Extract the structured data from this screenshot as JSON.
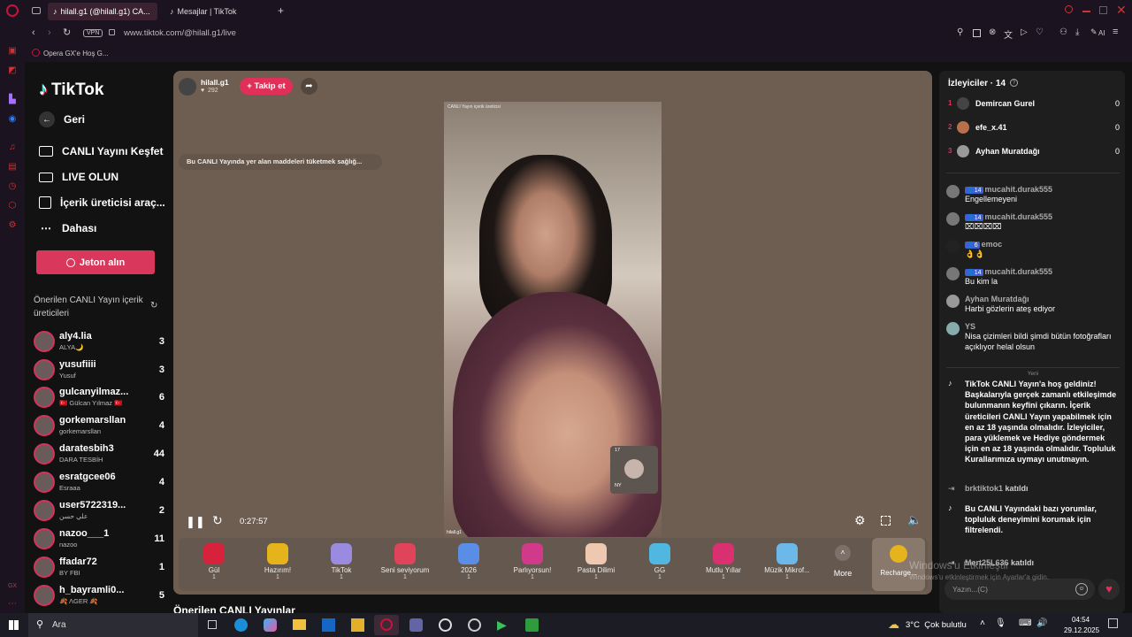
{
  "browser": {
    "tabs": [
      {
        "label": "hilall.g1 (@hilall.g1) CA..."
      },
      {
        "label": "Mesajlar | TikTok"
      }
    ],
    "new_tab": "+",
    "url": "www.tiktok.com/@hilall.g1/live",
    "vpn": "VPN",
    "bookmark": "Opera GX'e Hoş G...",
    "ai": "AI",
    "gx": "GX"
  },
  "nav": {
    "logo": "TikTok",
    "back": "Geri",
    "items": [
      {
        "label": "CANLI Yayını Keşfet"
      },
      {
        "label": "LIVE OLUN"
      },
      {
        "label": "İçerik üreticisi araç..."
      },
      {
        "label": "Dahası"
      }
    ],
    "coins": "Jeton alın",
    "suggested_title": "Önerilen CANLI Yayın içerik üreticileri",
    "accounts": [
      {
        "name": "aly4.lia",
        "sub": "ALYA🌙",
        "count": "3"
      },
      {
        "name": "yusufiiii",
        "sub": "Yusuf",
        "count": "3"
      },
      {
        "name": "gulcanyilmaz...",
        "sub": "🇹🇷 Gülcan Yılmaz 🇹🇷",
        "count": "6"
      },
      {
        "name": "gorkemarsllan",
        "sub": "gorkemarsllan",
        "count": "4"
      },
      {
        "name": "daratesbih3",
        "sub": "DARA TESBİH",
        "count": "44"
      },
      {
        "name": "esratgcee06",
        "sub": "Esraaa",
        "count": "4"
      },
      {
        "name": "user5722319...",
        "sub": "علي حسن",
        "count": "2"
      },
      {
        "name": "nazoo___1",
        "sub": "nazoo",
        "count": "11"
      },
      {
        "name": "ffadar72",
        "sub": "BY FBI",
        "count": "1"
      },
      {
        "name": "h_bayramli0...",
        "sub": "🍂 ΛGER 🍂",
        "count": "5"
      }
    ]
  },
  "stream": {
    "host": "hilall.g1",
    "host_likes": "292",
    "follow": "+ Takip et",
    "notice": "Bu CANLI Yayında yer alan maddeleri tüketmek sağlığ...",
    "video_tag": "CANLI Yayın içerik üreticisi",
    "watermark": "hilall.g1",
    "pip_count": "17",
    "pip_label": "NY",
    "time": "0:27:57",
    "section_title": "Önerilen CANLI Yayınlar"
  },
  "gifts": [
    {
      "label": "Gül",
      "price": "1",
      "color": "#d7223e"
    },
    {
      "label": "Hazırım!",
      "price": "1",
      "color": "#e5b31c"
    },
    {
      "label": "TikTok",
      "price": "1",
      "color": "#9b8be0"
    },
    {
      "label": "Seni seviyorum",
      "price": "1",
      "color": "#e0445a"
    },
    {
      "label": "2026",
      "price": "1",
      "color": "#5a8ee6"
    },
    {
      "label": "Parlıyorsun!",
      "price": "1",
      "color": "#d13a8a"
    },
    {
      "label": "Pasta Dilimi",
      "price": "1",
      "color": "#eec8b0"
    },
    {
      "label": "GG",
      "price": "1",
      "color": "#4fb7e0"
    },
    {
      "label": "Mutlu Yıllar",
      "price": "1",
      "color": "#d93070"
    },
    {
      "label": "Müzik Mikrof...",
      "price": "1",
      "color": "#6cb8e8"
    }
  ],
  "gift_more": "More",
  "recharge": "Recharge...",
  "viewers": {
    "title": "İzleyiciler · 14",
    "list": [
      {
        "rank": "1",
        "name": "Demircan Gurel",
        "score": "0"
      },
      {
        "rank": "2",
        "name": "efe_x.41",
        "score": "0"
      },
      {
        "rank": "3",
        "name": "Ayhan Muratdağı",
        "score": "0"
      }
    ]
  },
  "chat": [
    {
      "badge": "14",
      "user": "mucahit.durak555",
      "msg": "Engellemeyeni"
    },
    {
      "badge": "14",
      "user": "mucahit.durak555",
      "msg": "⌧⌧⌧⌧"
    },
    {
      "badge": "6",
      "user": "emoc",
      "msg": "👌👌"
    },
    {
      "badge": "14",
      "user": "mucahit.durak555",
      "msg": "Bu kim la"
    },
    {
      "badge": "",
      "user": "Ayhan Muratdağı",
      "msg": "Harbi gözlerin ateş ediyor"
    },
    {
      "badge": "",
      "user": "YS",
      "msg": "Nisa çizimleri bildi şimdi bütün fotoğrafları açıklıyor helal olsun"
    }
  ],
  "new_label": "Yeni",
  "system": "TikTok CANLI Yayın'a hoş geldiniz! Başkalarıyla gerçek zamanlı etkileşimde bulunmanın keyfini çıkarın. İçerik üreticileri CANLI Yayın yapabilmek için en az 18 yaşında olmalıdır. İzleyiciler, para yüklemek ve Hediye göndermek için en az 18 yaşında olmalıdır. Topluluk Kurallarımıza uymayı unutmayın.",
  "joined1": {
    "user": "brktiktok1",
    "text": "katıldı"
  },
  "filter_msg": "Bu CANLI Yayındaki bazı yorumlar, topluluk deneyimini korumak için filtrelendi.",
  "joined2": {
    "user": "Mert25L636",
    "text": "katıldı"
  },
  "chat_placeholder": "Yazın...(C)",
  "windows_watermark": "Windows'u Etkinleştir",
  "windows_watermark2": "Windows'u etkinleştirmek için Ayarlar'a gidin.",
  "taskbar": {
    "search": "Ara",
    "weather": "3°C  Çok bulutlu",
    "time": "04:54",
    "date": "29.12.2025"
  }
}
